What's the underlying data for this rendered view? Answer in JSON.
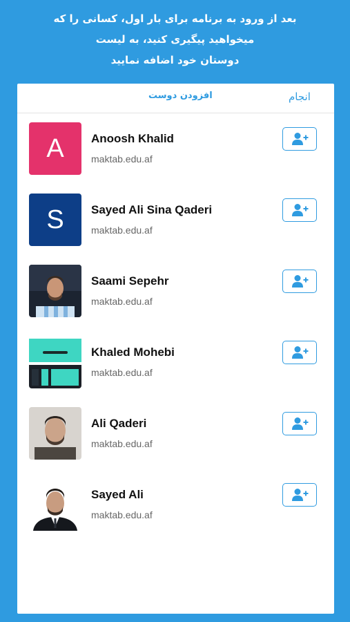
{
  "intro": {
    "lines": [
      "بعد از ورود به برنامه برای بار اول، کسانی را که",
      "میخواهید پیگیری کنید، به لیست",
      "دوستان خود اضافه نمایید"
    ]
  },
  "header": {
    "done_label": "انجام",
    "title": "افزودن دوست"
  },
  "colors": {
    "background": "#2f9be0",
    "accent": "#2f9be0",
    "avatar_a": "#e4326b",
    "avatar_s": "#0d3e87"
  },
  "users": [
    {
      "name": "Anoosh Khalid",
      "domain": "maktab.edu.af",
      "avatar_letter": "A",
      "avatar_type": "letter",
      "avatar_color": "#e4326b",
      "action_icon": "add-user-icon"
    },
    {
      "name": "Sayed Ali Sina Qaderi",
      "domain": "maktab.edu.af",
      "avatar_letter": "S",
      "avatar_type": "letter",
      "avatar_color": "#0d3e87",
      "action_icon": "add-user-icon"
    },
    {
      "name": "Saami Sepehr",
      "domain": "maktab.edu.af",
      "avatar_type": "photo",
      "action_icon": "add-user-icon"
    },
    {
      "name": "Khaled Mohebi",
      "domain": "maktab.edu.af",
      "avatar_type": "screenshot",
      "action_icon": "add-user-icon"
    },
    {
      "name": "Ali Qaderi",
      "domain": "maktab.edu.af",
      "avatar_type": "photo",
      "action_icon": "add-user-icon"
    },
    {
      "name": "Sayed Ali",
      "domain": "maktab.edu.af",
      "avatar_type": "photo",
      "action_icon": "add-user-icon"
    }
  ]
}
